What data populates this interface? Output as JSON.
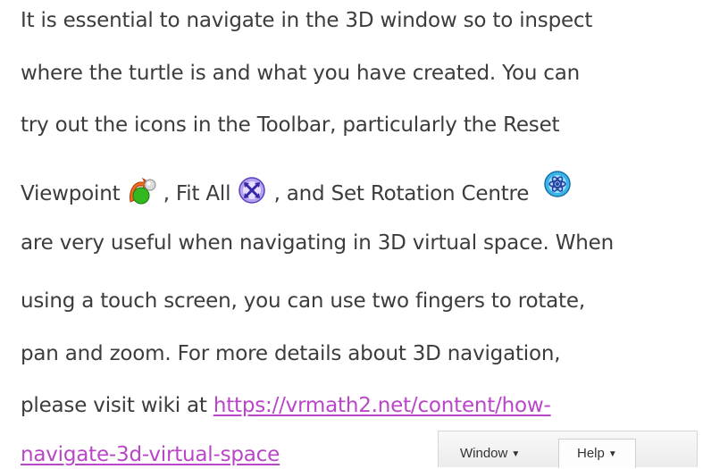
{
  "paragraph": {
    "line1": "It is essential to navigate in the 3D window so to inspect",
    "line2": "where the turtle is and what you have created. You can",
    "line3": "try out the icons in the Toolbar, particularly the Reset",
    "line4a": "Viewpoint",
    "line4b": ",  Fit All",
    "line4c": ", and Set Rotation Centre",
    "line5": "are very useful when navigating in 3D virtual space. When",
    "line6": "using a touch screen, you can use two fingers to rotate,",
    "line7": "pan and zoom. For more details about 3D navigation,",
    "line8a": "please visit wiki at ",
    "link_part1": "https://vrmath2.net/content/how-",
    "link_part2": "navigate-3d-virtual-space"
  },
  "icons": {
    "reset_viewpoint": "reset-viewpoint-icon",
    "fit_all": "fit-all-icon",
    "set_rotation_centre": "set-rotation-centre-icon"
  },
  "menubar": {
    "window_label": "Window",
    "help_label": "Help"
  },
  "colors": {
    "text": "#3c3c3c",
    "link": "#b946c8"
  }
}
